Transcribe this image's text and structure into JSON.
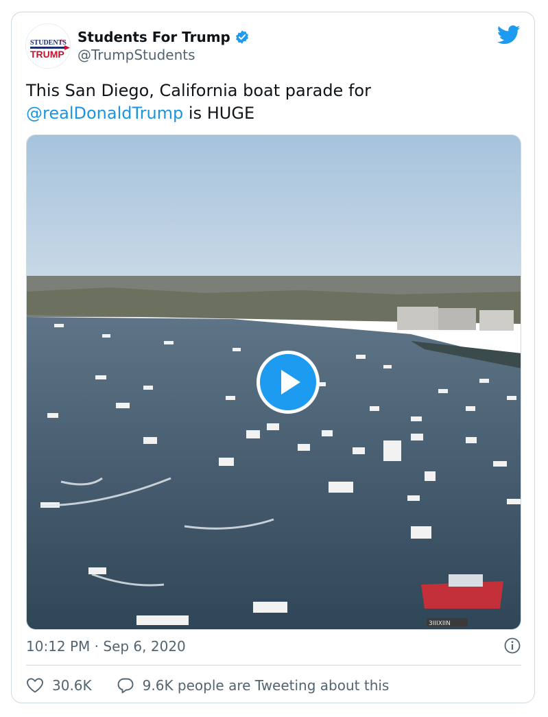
{
  "author": {
    "display_name": "Students For Trump",
    "handle": "@TrumpStudents",
    "avatar": {
      "line1": "STUDENTS",
      "line1_suffix": "for",
      "line2": "TRUMP"
    }
  },
  "tweet": {
    "text_before": "This San Diego, California boat parade for",
    "mention": "@realDonaldTrump",
    "text_after": " is HUGE"
  },
  "media": {
    "type": "video",
    "sign_text": "3IIIXIIN"
  },
  "meta": {
    "timestamp": "10:12 PM · Sep 6, 2020"
  },
  "actions": {
    "likes": "30.6K",
    "conversation": "9.6K people are Tweeting about this"
  },
  "icons": {
    "verified": "verified-badge-icon",
    "bird": "twitter-bird-icon",
    "play": "play-icon",
    "info": "info-icon",
    "like": "heart-icon",
    "reply": "speech-bubble-icon"
  },
  "colors": {
    "accent": "#1d9bf0",
    "mention": "#1b95e0",
    "secondary_text": "#536471",
    "border": "#cfd9de"
  }
}
